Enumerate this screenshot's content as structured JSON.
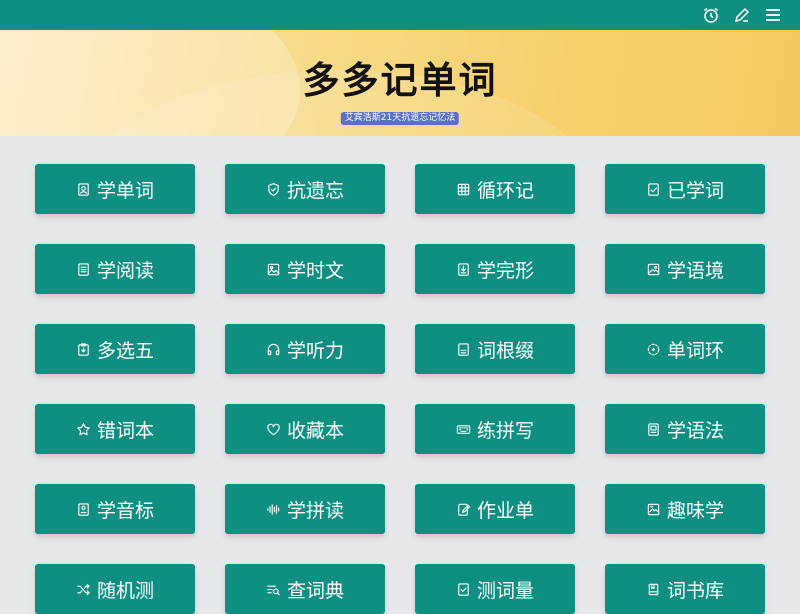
{
  "app": {
    "title": "多多记单词",
    "subtitle": "艾宾浩斯21天抗遗忘记忆法"
  },
  "topbar": {
    "icons": [
      "alarm-icon",
      "edit-icon",
      "menu-icon"
    ]
  },
  "menu": {
    "items": [
      {
        "label": "学单词",
        "icon": "portrait-card-icon"
      },
      {
        "label": "抗遗忘",
        "icon": "shield-icon"
      },
      {
        "label": "循环记",
        "icon": "grid-icon"
      },
      {
        "label": "已学词",
        "icon": "checked-doc-icon"
      },
      {
        "label": "学阅读",
        "icon": "document-icon"
      },
      {
        "label": "学时文",
        "icon": "image-icon"
      },
      {
        "label": "学完形",
        "icon": "download-doc-icon"
      },
      {
        "label": "学语境",
        "icon": "image-doc-icon"
      },
      {
        "label": "多选五",
        "icon": "clipboard-icon"
      },
      {
        "label": "学听力",
        "icon": "headphones-icon"
      },
      {
        "label": "词根缀",
        "icon": "list-doc-icon"
      },
      {
        "label": "单词环",
        "icon": "dashed-circle-icon"
      },
      {
        "label": "错词本",
        "icon": "star-icon"
      },
      {
        "label": "收藏本",
        "icon": "heart-icon"
      },
      {
        "label": "练拼写",
        "icon": "keyboard-icon"
      },
      {
        "label": "学语法",
        "icon": "book-doc-icon"
      },
      {
        "label": "学音标",
        "icon": "person-doc-icon"
      },
      {
        "label": "学拼读",
        "icon": "audio-wave-icon"
      },
      {
        "label": "作业单",
        "icon": "edit-doc-icon"
      },
      {
        "label": "趣味学",
        "icon": "picture-doc-icon"
      },
      {
        "label": "随机测",
        "icon": "shuffle-icon"
      },
      {
        "label": "查词典",
        "icon": "search-list-icon"
      },
      {
        "label": "测词量",
        "icon": "check-doc-icon"
      },
      {
        "label": "词书库",
        "icon": "book-icon"
      }
    ]
  },
  "colors": {
    "primary": "#0f8f82",
    "background": "#e6e8ea",
    "hero_gold": "#f5d06a",
    "subtitle_badge": "#5b6fc8"
  }
}
